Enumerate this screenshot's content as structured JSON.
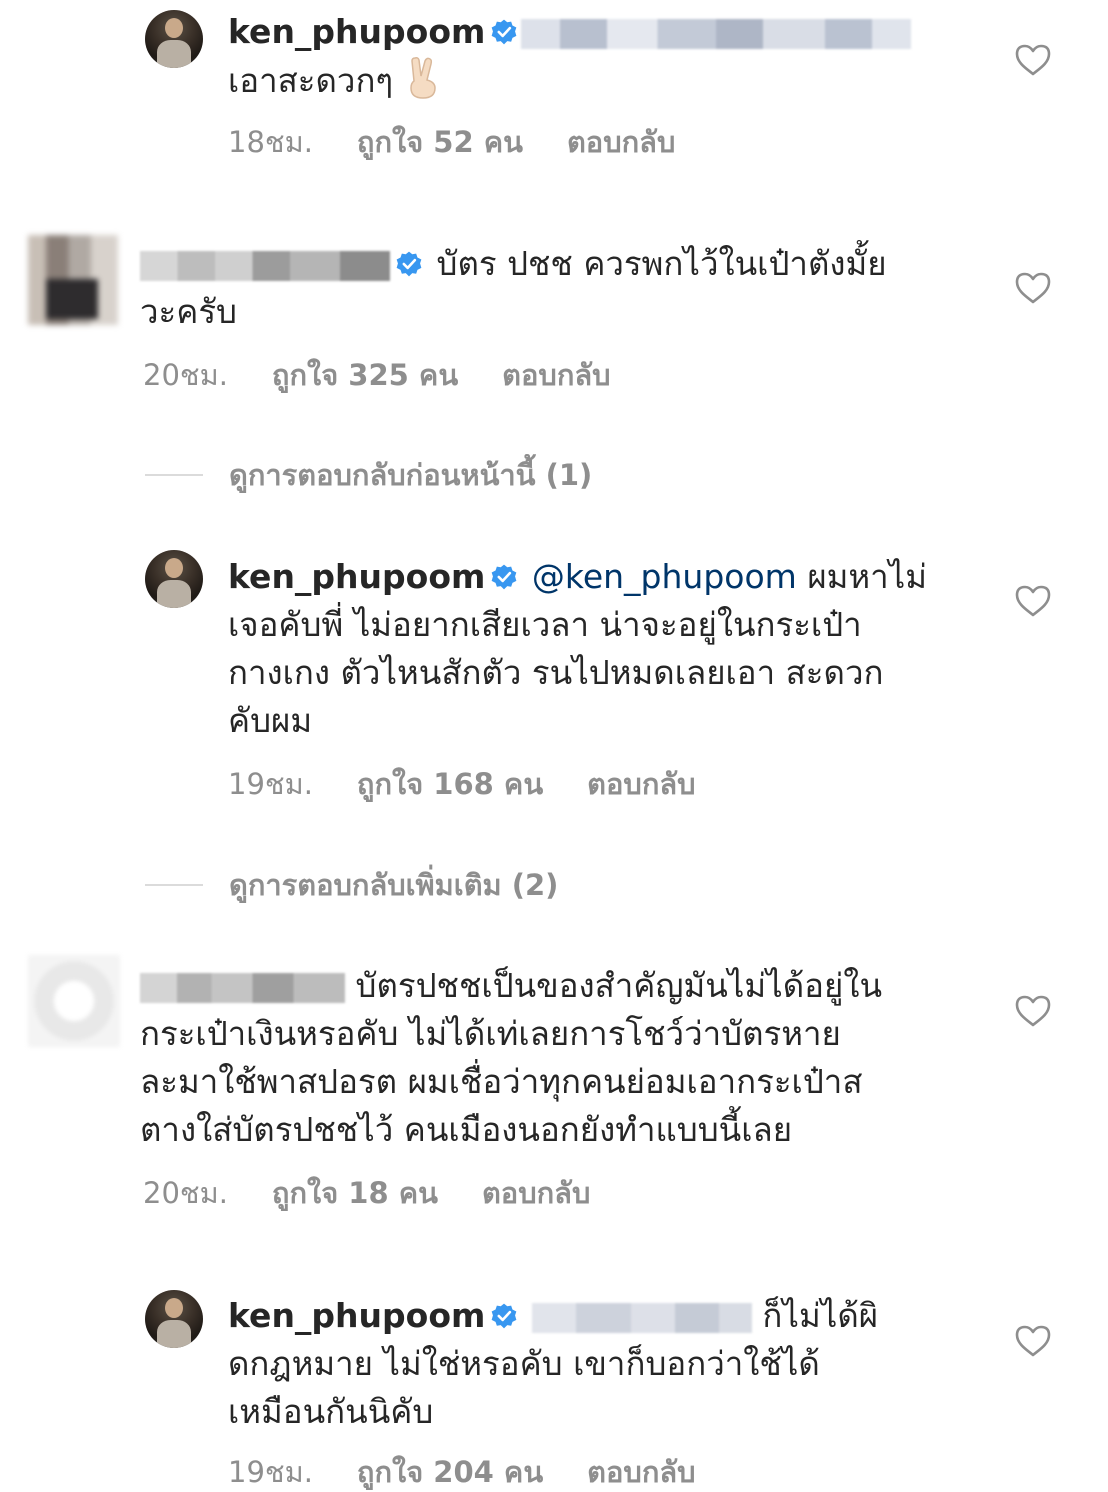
{
  "comments": [
    {
      "username": "ken_phupoom",
      "text": "เอาสะดวกๆ",
      "emoji": "victory-hand",
      "time": "18ชม.",
      "likes": "ถูกใจ 52 คน",
      "reply": "ตอบกลับ"
    },
    {
      "username": "",
      "text_line1": "บัตร ปชช ควรพกไว้ในเป๋าตังมั้ย",
      "text_line2": "วะครับ",
      "time": "20ชม.",
      "likes": "ถูกใจ 325 คน",
      "reply": "ตอบกลับ"
    },
    {
      "username": "ken_phupoom",
      "mention": "@ken_phupoom",
      "text_line1": "ผมหาไม่",
      "text_line2": "เจอคับพี่ ไม่อยากเสียเวลา น่าจะอยู่ในกระเป๋า",
      "text_line3": "กางเกง ตัวไหนสักตัว รนไปหมดเลยเอา สะดวก",
      "text_line4": "คับผม",
      "time": "19ชม.",
      "likes": "ถูกใจ 168 คน",
      "reply": "ตอบกลับ"
    },
    {
      "username": "",
      "text_line1": "บัตรปชชเป็นของสำคัญมันไม่ได้อยู่ใน",
      "text_line2": "กระเป๋าเงินหรอคับ ไม่ได้เท่เลยการโชว์ว่าบัตรหาย",
      "text_line3": "ละมาใช้พาสปอรต ผมเชื่อว่าทุกคนย่อมเอากระเป๋าส",
      "text_line4": "ตางใส่บัตรปชชไว้ คนเมืองนอกยังทำแบบนี้เลย",
      "time": "20ชม.",
      "likes": "ถูกใจ 18 คน",
      "reply": "ตอบกลับ"
    },
    {
      "username": "ken_phupoom",
      "text_line1": "ก็ไม่ได้ผิ",
      "text_line2": "ดกฎหมาย ไม่ใช่หรอคับ เขาก็บอกว่าใช้ได้",
      "text_line3": "เหมือนกันนิคับ",
      "time": "19ชม.",
      "likes": "ถูกใจ 204 คน",
      "reply": "ตอบกลับ"
    }
  ],
  "view_replies": [
    {
      "label": "ดูการตอบกลับก่อนหน้านี้ (1)"
    },
    {
      "label": "ดูการตอบกลับเพิ่มเติม (2)"
    }
  ],
  "colors": {
    "text": "#262626",
    "meta": "#8e8e8e",
    "verified": "#3897f0",
    "divider": "#dbdbdb"
  },
  "icons": [
    "verified-badge-icon",
    "heart-icon",
    "victory-hand-emoji"
  ]
}
